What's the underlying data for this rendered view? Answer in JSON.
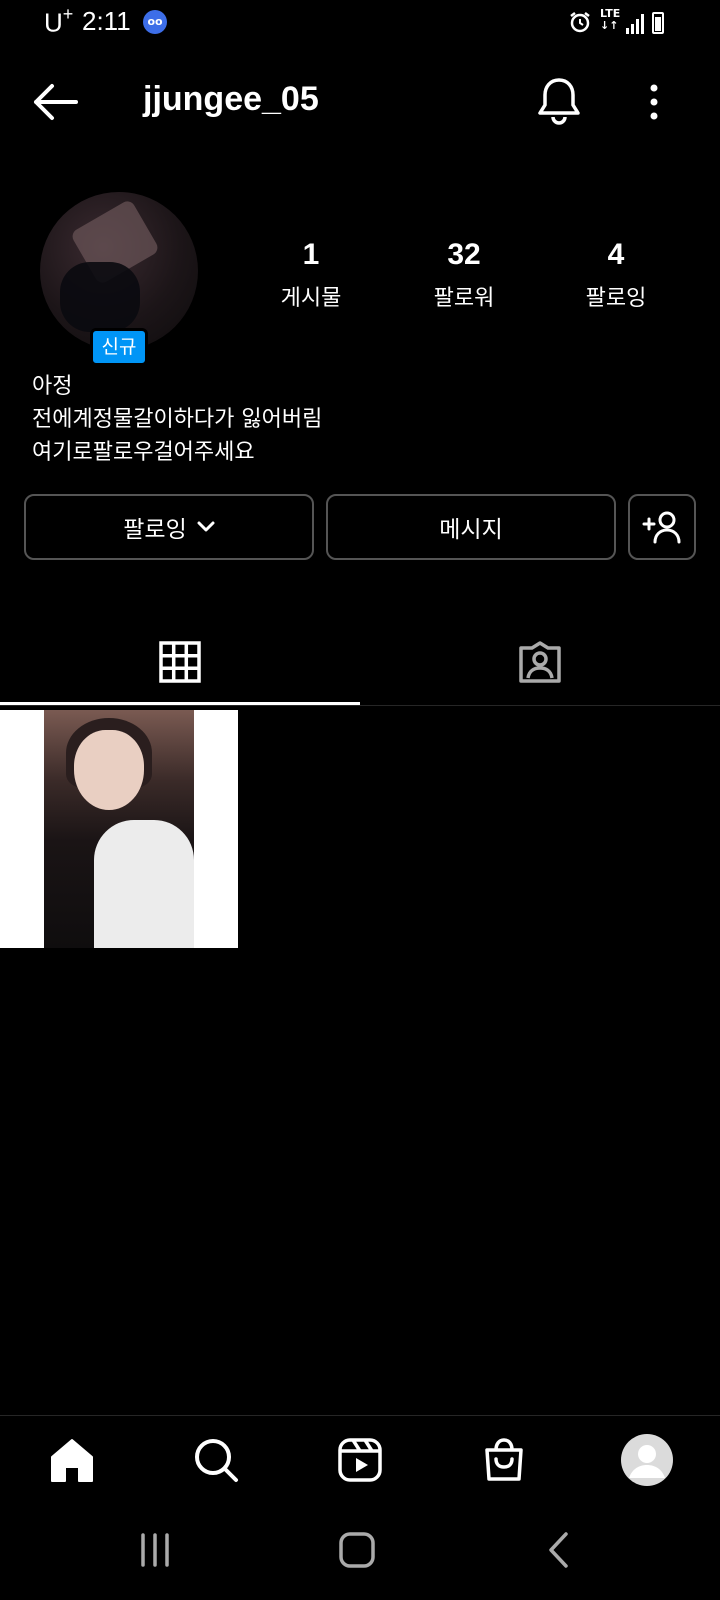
{
  "status_bar": {
    "carrier": "U",
    "carrier_sup": "+",
    "time": "2:11",
    "network": "LTE"
  },
  "header": {
    "username": "jjungee_05"
  },
  "profile": {
    "new_badge": "신규",
    "stats": [
      {
        "value": "1",
        "label": "게시물"
      },
      {
        "value": "32",
        "label": "팔로워"
      },
      {
        "value": "4",
        "label": "팔로잉"
      }
    ],
    "bio_lines": [
      "아정",
      "전에계정물갈이하다가 잃어버림",
      "여기로팔로우걸어주세요"
    ]
  },
  "actions": {
    "following_label": "팔로잉",
    "message_label": "메시지"
  },
  "colors": {
    "accent": "#0095f6",
    "background": "#000000",
    "border": "#555555"
  }
}
